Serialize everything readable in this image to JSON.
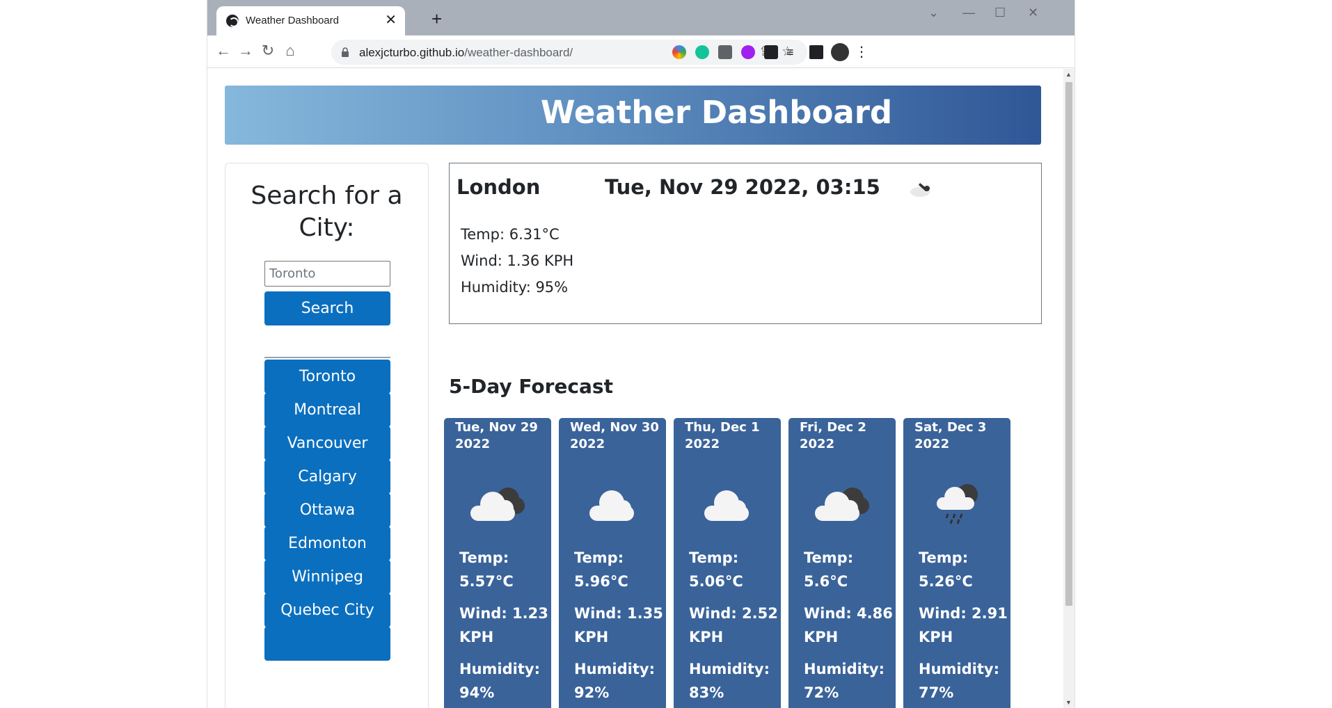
{
  "browser": {
    "tab_title": "Weather Dashboard",
    "tab_close": "✕",
    "new_tab": "+",
    "url_host": "alexjcturbo.github.io",
    "url_path": "/weather-dashboard/"
  },
  "header": {
    "title": "Weather Dashboard"
  },
  "sidebar": {
    "title": "Search for a City:",
    "search_value": "Toronto",
    "search_button": "Search",
    "cities": [
      "Toronto",
      "Montreal",
      "Vancouver",
      "Calgary",
      "Ottawa",
      "Edmonton",
      "Winnipeg",
      "Quebec City"
    ],
    "primary_color": "#0b6fbf"
  },
  "current": {
    "city": "London",
    "datetime": "Tue, Nov 29 2022, 03:15",
    "icon": "partly-cloudy-night-icon",
    "temp": "Temp: 6.31°C",
    "wind": "Wind: 1.36 KPH",
    "humidity": "Humidity: 95%"
  },
  "forecast": {
    "title": "5-Day Forecast",
    "card_color": "#3a639a",
    "days": [
      {
        "date_line1": "Tue, Nov 29",
        "date_line2": "2022",
        "icon": "broken-clouds-icon",
        "temp_label": "Temp:",
        "temp_value": "5.57°C",
        "wind_label": "Wind: 1.23",
        "wind_unit": "KPH",
        "humidity_label": "Humidity:",
        "humidity_value": "94%"
      },
      {
        "date_line1": "Wed, Nov 30",
        "date_line2": "2022",
        "icon": "cloud-icon",
        "temp_label": "Temp:",
        "temp_value": "5.96°C",
        "wind_label": "Wind: 1.35",
        "wind_unit": "KPH",
        "humidity_label": "Humidity:",
        "humidity_value": "92%"
      },
      {
        "date_line1": "Thu, Dec 1",
        "date_line2": "2022",
        "icon": "cloud-icon",
        "temp_label": "Temp:",
        "temp_value": "5.06°C",
        "wind_label": "Wind: 2.52",
        "wind_unit": "KPH",
        "humidity_label": "Humidity:",
        "humidity_value": "83%"
      },
      {
        "date_line1": "Fri, Dec 2",
        "date_line2": "2022",
        "icon": "broken-clouds-icon",
        "temp_label": "Temp:",
        "temp_value": "5.6°C",
        "wind_label": "Wind: 4.86",
        "wind_unit": "KPH",
        "humidity_label": "Humidity:",
        "humidity_value": "72%"
      },
      {
        "date_line1": "Sat, Dec 3",
        "date_line2": "2022",
        "icon": "rain-cloud-icon",
        "temp_label": "Temp:",
        "temp_value": "5.26°C",
        "wind_label": "Wind: 2.91",
        "wind_unit": "KPH",
        "humidity_label": "Humidity:",
        "humidity_value": "77%"
      }
    ]
  }
}
